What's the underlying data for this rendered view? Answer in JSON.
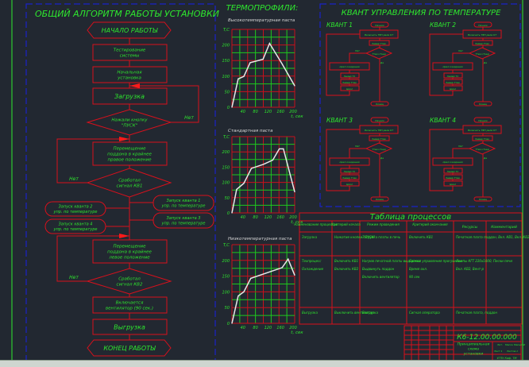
{
  "colors": {
    "background": "#222831",
    "lines": "#d8101c",
    "text": "#2ee82e",
    "curve": "#e8e8e8",
    "frame": "#1a22c8"
  },
  "algorithm": {
    "title": "ОБЩИЙ АЛГОРИТМ РАБОТЫ УСТАНОВКИ",
    "start": "НАЧАЛО РАБОТЫ",
    "test": [
      "Тестирование",
      "системы"
    ],
    "init": [
      "Начальная",
      "установка"
    ],
    "load": "Загрузка",
    "start_decision": [
      "Нажали кнопку",
      "\"ПУСК\""
    ],
    "move_right": [
      "Перемещение",
      "поддона в крайнее",
      "правое положение"
    ],
    "kv1_decision": [
      "Сработал",
      "сигнал КВ1"
    ],
    "kvant2": [
      "Запуск кванта 2",
      "упр. по температуре"
    ],
    "kvant4": [
      "Запуск кванта 4",
      "упр. по температуре"
    ],
    "kvant1": [
      "Запуск кванта 1",
      "упр. по температуре"
    ],
    "kvant3": [
      "Запуск кванта 3",
      "упр. по температуре"
    ],
    "move_left": [
      "Перемещение",
      "поддона в крайнее",
      "левое положение"
    ],
    "kv2_decision": [
      "Сработал",
      "сигнал КВ2"
    ],
    "fan": [
      "Включается",
      "вентилятор (90 сек.)"
    ],
    "unload": "Выгрузка",
    "end": "КОНЕЦ РАБОТЫ",
    "no_label": "Нет"
  },
  "thermo_title": "ТЕРМОПРОФИЛИ:",
  "chart_data": [
    {
      "type": "line",
      "title": "Высокотемпературная паста",
      "xlabel": "t, сек",
      "ylabel": "T,C",
      "xlim": [
        0,
        200
      ],
      "ylim": [
        0,
        250
      ],
      "xticks": [
        40,
        80,
        120,
        160,
        200
      ],
      "yticks": [
        0,
        50,
        100,
        150,
        200
      ],
      "grid": true,
      "x": [
        0,
        20,
        38,
        58,
        99,
        120,
        160,
        200
      ],
      "y": [
        0,
        91,
        99,
        143,
        154,
        205,
        139,
        69
      ]
    },
    {
      "type": "line",
      "title": "Стандартная паста",
      "xlabel": "t, сек",
      "ylabel": "T,C",
      "xlim": [
        0,
        200
      ],
      "ylim": [
        0,
        250
      ],
      "xticks": [
        40,
        80,
        120,
        160,
        200
      ],
      "yticks": [
        0,
        50,
        100,
        150,
        200
      ],
      "grid": true,
      "x": [
        0,
        15,
        38,
        62,
        100,
        130,
        151,
        164,
        200
      ],
      "y": [
        0,
        77,
        97,
        146,
        159,
        173,
        210,
        210,
        69
      ]
    },
    {
      "type": "line",
      "title": "Низкотемпературная паста",
      "xlabel": "t, сек",
      "ylabel": "T,C",
      "xlim": [
        0,
        200
      ],
      "ylim": [
        0,
        250
      ],
      "xticks": [
        40,
        80,
        120,
        160,
        200
      ],
      "yticks": [
        0,
        50,
        100,
        150,
        200
      ],
      "grid": true,
      "x": [
        0,
        20,
        38,
        60,
        160,
        179,
        200
      ],
      "y": [
        0,
        87,
        100,
        143,
        177,
        204,
        153
      ]
    }
  ],
  "kvant": {
    "title": "КВАНТ УПРАВЛЕНИЯ ПО ТЕМПЕРАТУРЕ",
    "blocks": [
      {
        "name": "КВАНТ 1"
      },
      {
        "name": "КВАНТ 2"
      },
      {
        "name": "КВАНТ 3"
      },
      {
        "name": "КВАНТ 4"
      }
    ],
    "start": "Начало",
    "heat": "Включить ТЭН реле КТ",
    "measure": "Замер Tтек",
    "cond": "Tтек<Tзад",
    "yes": "Да",
    "no": "Нет",
    "wait": "Цикл ожидания",
    "s1": "Замер T1",
    "s2": "Замер Tтек",
    "s3": "Цикл",
    "end": "Конец"
  },
  "table": {
    "title": "Таблица процессов",
    "headers": [
      "Наименование процессов",
      "Критерий начала",
      "Режим проведения",
      "Критерий окончания",
      "Ресурсы",
      "Комментарий"
    ],
    "rows": [
      [
        "Загрузка",
        "Нажатие кнопки \"ПУСК\"",
        "Загрузка платы в печь",
        "Включить КВ1",
        "Печатная плата поддон, Вкл. КВ1, Вкл. КВ2",
        ""
      ],
      [
        "Техпроцесс\n\nОхлаждение",
        "Включить КВ1\n\nВключить КВ2",
        "Нагрев печатной платы выдержка\nВыдвинуть поддон\nВключить вентилятор",
        "Сигнал управления программы\nВремя охл.\n90 сек",
        "Лампы КГТ 220х1000, Пески печи\nВкл. КВ2, Вент-р",
        ""
      ],
      [
        "Выгрузка",
        "Выключить вентилятор",
        "Выгрузка",
        "Сигнал оператора",
        "Печатная плата, поддон",
        ""
      ]
    ]
  },
  "stamp": {
    "code": "К6-12.00.00.000",
    "name": [
      "Принципиальная",
      "схема",
      "установки"
    ],
    "lit": "Лит.",
    "mass": "Масса",
    "scale": "Масштаб",
    "sheet": "Лист 1",
    "sheets": "Листов 1",
    "dept": "УГПУ Каф. ТМ"
  }
}
